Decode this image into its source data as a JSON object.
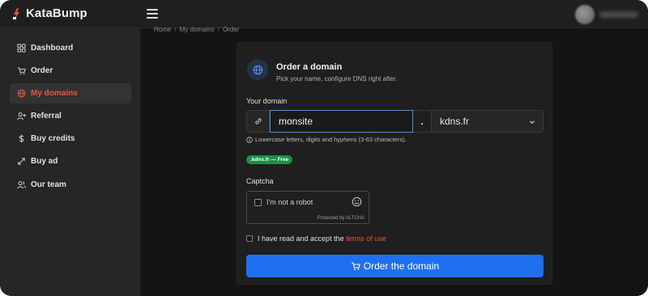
{
  "app": {
    "name": "KataBump"
  },
  "sidebar": {
    "items": [
      {
        "label": "Dashboard",
        "icon": "grid-icon"
      },
      {
        "label": "Order",
        "icon": "cart-icon"
      },
      {
        "label": "My domains",
        "icon": "globe-icon",
        "active": true
      },
      {
        "label": "Referral",
        "icon": "user-plus-icon"
      },
      {
        "label": "Buy credits",
        "icon": "dollar-icon"
      },
      {
        "label": "Buy ad",
        "icon": "expand-arrows-icon"
      },
      {
        "label": "Our team",
        "icon": "users-icon"
      }
    ]
  },
  "breadcrumb": [
    "Home",
    "My domains",
    "Order"
  ],
  "card": {
    "title": "Order a domain",
    "subtitle": "Pick your name, configure DNS right after."
  },
  "form": {
    "domain_label": "Your domain",
    "domain_value": "monsite",
    "dot": ".",
    "extension_value": "kdns.fr",
    "hint": "Lowercase letters, digits and hyphens (3-63 characters).",
    "badge": ".kdns.fr — Free",
    "captcha_label": "Captcha",
    "captcha_text": "I'm not a robot",
    "captcha_footer": "Protected by ALTCHA",
    "terms_text": "I have read and accept the",
    "terms_link": "terms of use",
    "submit_label": "Order the domain"
  },
  "colors": {
    "accent_red": "#e8553d",
    "primary_blue": "#1f6ff0",
    "badge_green": "#1e8e4a"
  }
}
